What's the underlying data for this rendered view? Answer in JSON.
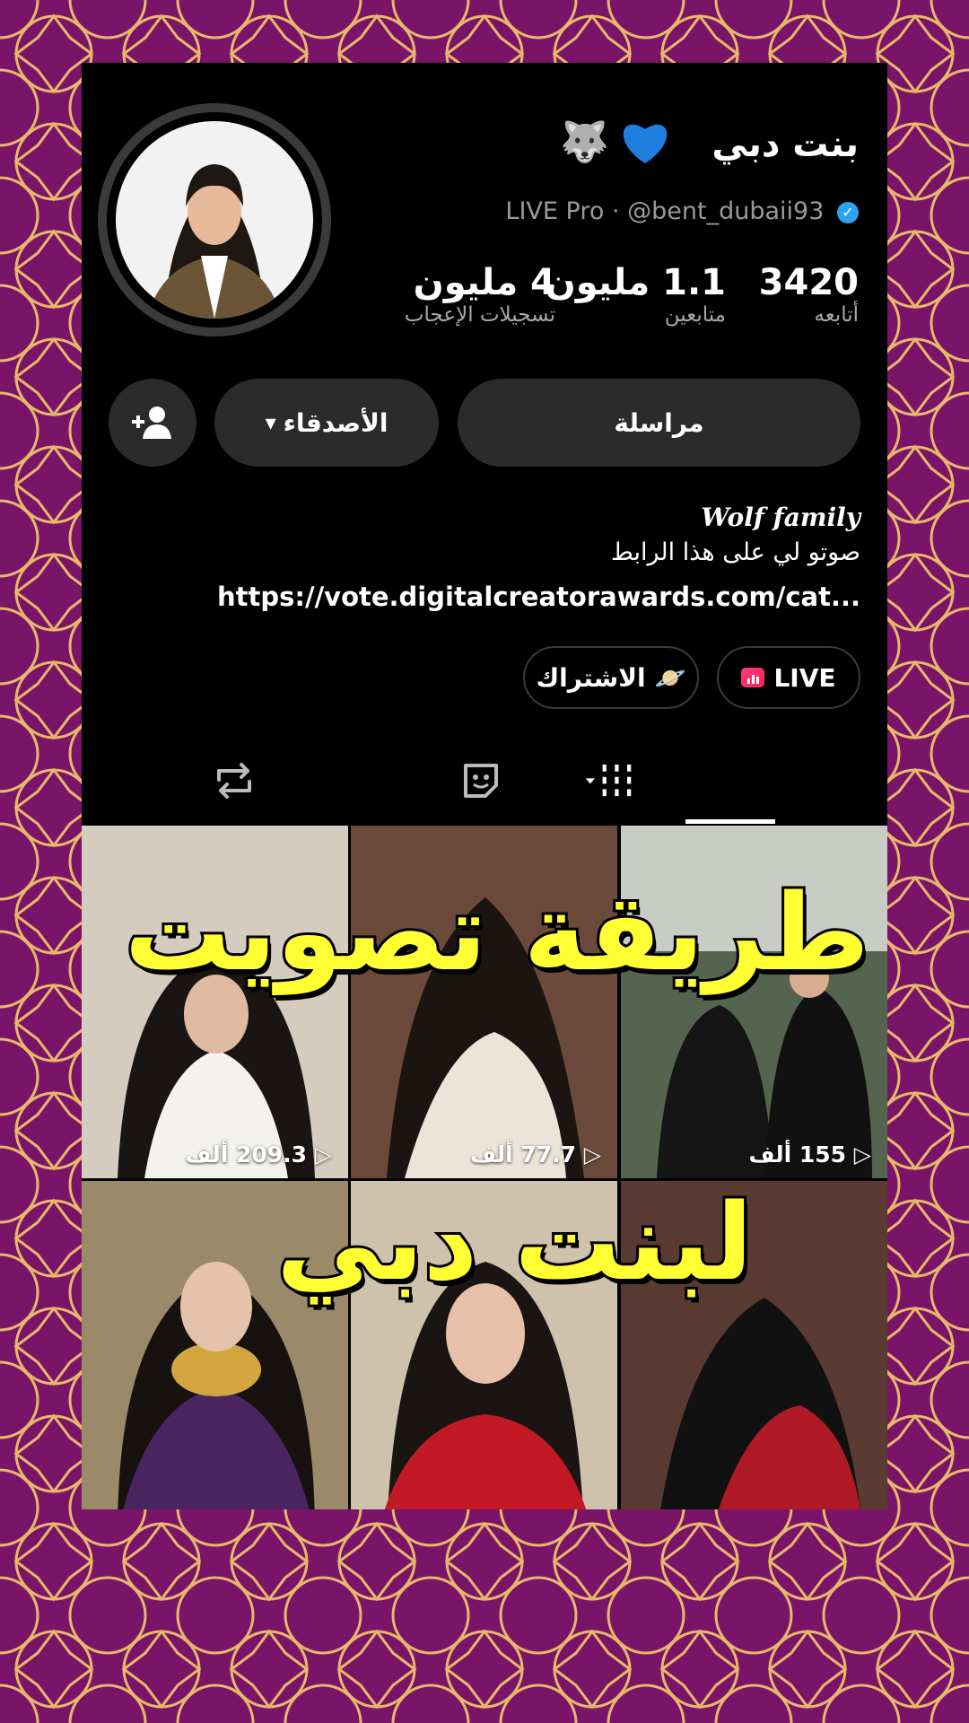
{
  "profile": {
    "display_name": "بنت دبي",
    "name_emojis": "🐺 💙",
    "handle": "@bent_dubaii93",
    "live_label": "LIVE Pro",
    "separator": "·"
  },
  "stats": [
    {
      "value": "3420",
      "label": "أتابعه"
    },
    {
      "value": "1.1 مليون",
      "label": "متابعين"
    },
    {
      "value": "4 مليون",
      "label": "تسجيلات الإعجاب"
    }
  ],
  "buttons": {
    "message": "مراسلة",
    "friends": "الأصدقاء",
    "friends_caret": "▾",
    "add_friend_icon": "person-add-icon"
  },
  "bio": {
    "title": "Wolf family",
    "text": "صوتو لي على هذا الرابط",
    "link": "https://vote.digitalcreatorawards.com/cat..."
  },
  "pills": {
    "live": "LIVE",
    "subscribe": "الاشتراك",
    "subscribe_emoji": "🪐"
  },
  "tabs": [
    "videos-grid-icon",
    "stickers-icon",
    "repost-icon"
  ],
  "videos": [
    {
      "views": "155 ألف"
    },
    {
      "views": "77.7 ألف"
    },
    {
      "views": "209.3 ألف"
    },
    {
      "views": ""
    },
    {
      "views": ""
    },
    {
      "views": ""
    }
  ],
  "overlay": {
    "line1": "طريقة تصويت",
    "line2": "لبنت دبي"
  },
  "colors": {
    "pattern_bg": "#7a1468",
    "pattern_line": "#e8b86a",
    "overlay_text": "#ffff33",
    "verified": "#2ba4f0"
  }
}
